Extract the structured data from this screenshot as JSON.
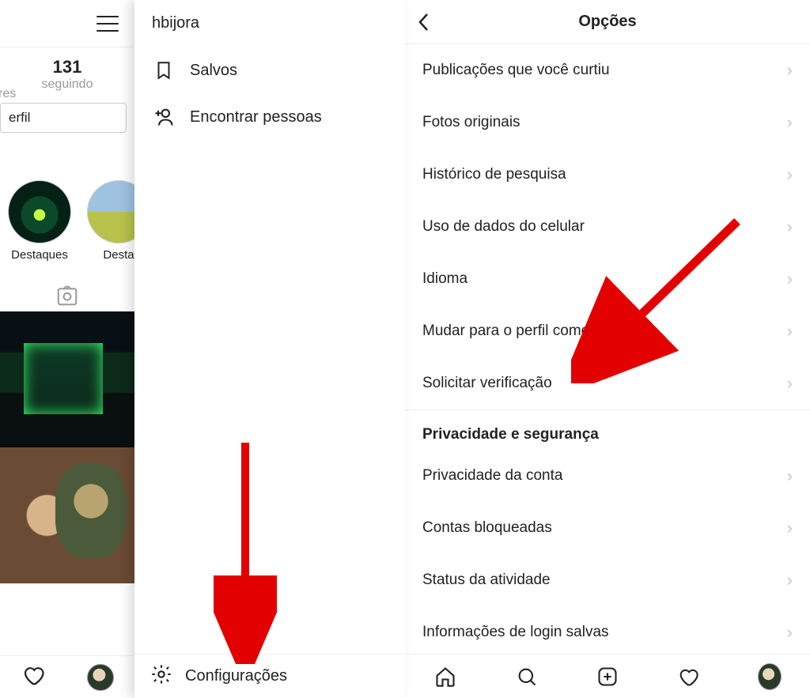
{
  "left": {
    "username": "hbijora",
    "stat_following_count": "131",
    "stat_following_label": "seguindo",
    "stat_followers_cut": "res",
    "edit_profile_cut": "erfil",
    "highlight1": "Destaques",
    "highlight2_cut": "Desta",
    "menu": {
      "saved": "Salvos",
      "find_people": "Encontrar pessoas",
      "settings": "Configurações"
    }
  },
  "right": {
    "title": "Opções",
    "items": [
      "Publicações que você curtiu",
      "Fotos originais",
      "Histórico de pesquisa",
      "Uso de dados do celular",
      "Idioma",
      "Mudar para o perfil comercial",
      "Solicitar verificação"
    ],
    "section": "Privacidade e segurança",
    "items2": [
      "Privacidade da conta",
      "Contas bloqueadas",
      "Status da atividade",
      "Informações de login salvas"
    ]
  }
}
